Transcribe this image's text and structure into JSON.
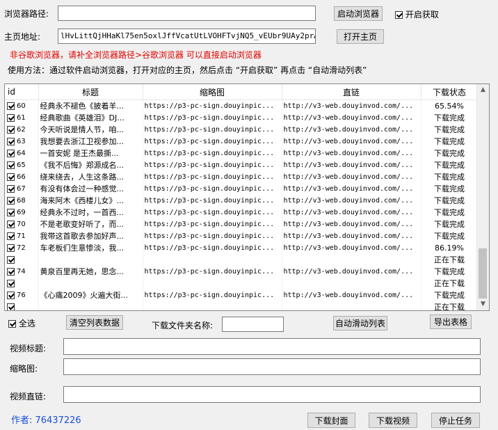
{
  "top": {
    "browser_path_label": "浏览器路径:",
    "browser_path_value": "",
    "launch_browser_btn": "启动浏览器",
    "enable_fetch_label": "开启获取",
    "homepage_label": "主页地址:",
    "homepage_value": "lHvLittQjHHaKl75en5oxlJffVcatUtLVOHFTvjNQ5_vEUbr9UAy2prAw7_M2",
    "open_home_btn": "打开主页",
    "warning": "非谷歌浏览器，请补全浏览器路径>谷歌浏览器 可以直接启动浏览器",
    "usage": "使用方法：通过软件启动浏览器，打开对应的主页，然后点击 “开启获取” 再点击 “自动滑动列表”"
  },
  "table": {
    "headers": [
      "id",
      "标题",
      "缩略图",
      "直链",
      "下载状态"
    ],
    "rows": [
      {
        "id": "60",
        "title": "经典永不褪色《披着羊...",
        "thumb": "https://p3-pc-sign.douyinpic...",
        "link": "http://v3-web.douyinvod.com/...",
        "status": "65.54%"
      },
      {
        "id": "61",
        "title": "经典歌曲《英雄泪》DJ...",
        "thumb": "https://p3-pc-sign.douyinpic...",
        "link": "http://v3-web.douyinvod.com/...",
        "status": "下载完成"
      },
      {
        "id": "62",
        "title": "今天听说是情人节，咱...",
        "thumb": "https://p3-pc-sign.douyinpic...",
        "link": "http://v3-web.douyinvod.com/...",
        "status": "下载完成"
      },
      {
        "id": "63",
        "title": "我想要去浙江卫视参加...",
        "thumb": "https://p3-pc-sign.douyinpic...",
        "link": "http://v3-web.douyinvod.com/...",
        "status": "下载完成"
      },
      {
        "id": "64",
        "title": "一首安妮 是王杰最撕...",
        "thumb": "https://p3-pc-sign.douyinpic...",
        "link": "http://v3-web.douyinvod.com/...",
        "status": "下载完成"
      },
      {
        "id": "65",
        "title": "《我不后悔》郑源成名...",
        "thumb": "https://p3-pc-sign.douyinpic...",
        "link": "http://v3-web.douyinvod.com/...",
        "status": "下载完成"
      },
      {
        "id": "66",
        "title": "绕来绕去，人生这条路...",
        "thumb": "https://p3-pc-sign.douyinpic...",
        "link": "http://v3-web.douyinvod.com/...",
        "status": "下载完成"
      },
      {
        "id": "67",
        "title": "有没有体会过一种感觉...",
        "thumb": "https://p3-pc-sign.douyinpic...",
        "link": "http://v3-web.douyinvod.com/...",
        "status": "下载完成"
      },
      {
        "id": "68",
        "title": "海来阿木《西楼儿女》...",
        "thumb": "https://p3-pc-sign.douyinpic...",
        "link": "http://v3-web.douyinvod.com/...",
        "status": "下载完成"
      },
      {
        "id": "69",
        "title": "经典永不过时，一首西...",
        "thumb": "https://p3-pc-sign.douyinpic...",
        "link": "http://v3-web.douyinvod.com/...",
        "status": "下载完成"
      },
      {
        "id": "70",
        "title": "不是老歌变好听了，而...",
        "thumb": "https://p3-pc-sign.douyinpic...",
        "link": "http://v3-web.douyinvod.com/...",
        "status": "下载完成"
      },
      {
        "id": "71",
        "title": "我带这首歌去参加好声...",
        "thumb": "https://p3-pc-sign.douyinpic...",
        "link": "http://v3-web.douyinvod.com/...",
        "status": "下载完成"
      },
      {
        "id": "72",
        "title": "车老板们生意惨淡，我...",
        "thumb": "https://p3-pc-sign.douyinpic...",
        "link": "http://v3-web.douyinvod.com/...",
        "status": "86.19%"
      },
      {
        "id": "",
        "title": "",
        "thumb": "",
        "link": "",
        "status": "正在下载"
      },
      {
        "id": "74",
        "title": "黄泉百里再无她，思念...",
        "thumb": "https://p3-pc-sign.douyinpic...",
        "link": "http://v3-web.douyinvod.com/...",
        "status": "下载完成"
      },
      {
        "id": "",
        "title": "",
        "thumb": "",
        "link": "",
        "status": "正在下载"
      },
      {
        "id": "76",
        "title": "《心痛2009》火遍大街...",
        "thumb": "https://p3-pc-sign.douyinpic...",
        "link": "http://v3-web.douyinvod.com/...",
        "status": "下载完成"
      },
      {
        "id": "",
        "title": "",
        "thumb": "",
        "link": "",
        "status": "正在下载"
      },
      {
        "id": "78",
        "title": "出生时我哭了，你笑了...",
        "thumb": "https://p3-pc-sign.douyinpic...",
        "link": "http://v3-web.douyinvod.com/...",
        "status": "下载完成"
      }
    ]
  },
  "controls": {
    "select_all_label": "全选",
    "clear_btn": "清空列表数据",
    "folder_label": "下载文件夹名称:",
    "folder_value": "",
    "auto_scroll_btn": "自动滑动列表",
    "export_btn": "导出表格"
  },
  "details": {
    "video_title_label": "视频标题:",
    "video_title_value": "",
    "thumb_label": "缩略图:",
    "thumb_value": "",
    "link_label": "视频直链:",
    "link_value": ""
  },
  "footer": {
    "author": "作者: 76437226",
    "download_cover_btn": "下载封面",
    "download_video_btn": "下载视频",
    "stop_btn": "停止任务"
  }
}
